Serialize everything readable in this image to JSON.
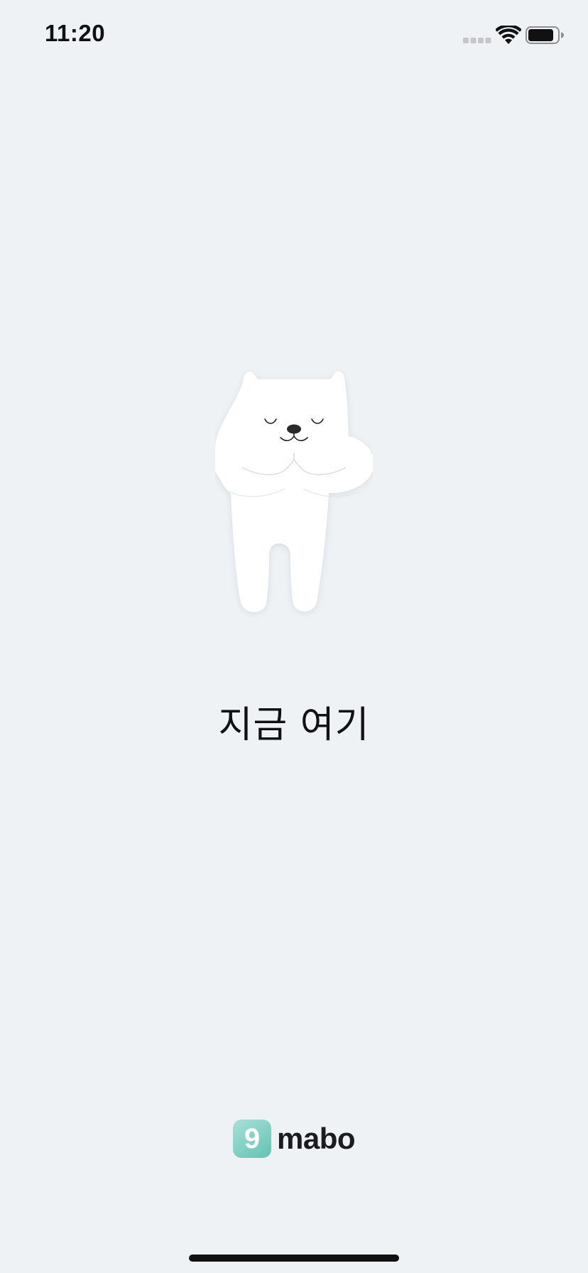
{
  "status_bar": {
    "time": "11:20",
    "icons": [
      "signal-icon",
      "wifi-icon",
      "battery-icon"
    ]
  },
  "splash": {
    "mascot": "meditating-bear-illustration",
    "tagline": "지금 여기"
  },
  "brand": {
    "logo_mark": "9",
    "name": "mabo",
    "accent_color": "#62c3b4"
  },
  "colors": {
    "background": "#eff2f5",
    "text": "#111111"
  }
}
